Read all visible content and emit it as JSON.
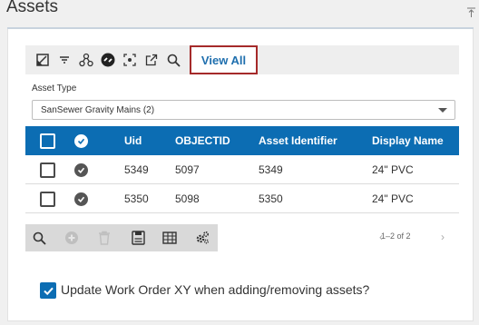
{
  "panel": {
    "title": "Assets"
  },
  "toolbar": {
    "icons": [
      "map-edit-icon",
      "filter-icon",
      "network-trace-icon",
      "link-icon",
      "focus-select-icon",
      "open-external-icon",
      "search-icon"
    ],
    "view_all_label": "View All"
  },
  "asset_type": {
    "label": "Asset Type",
    "selected": "SanSewer Gravity Mains (2)"
  },
  "grid": {
    "columns": [
      "Uid",
      "OBJECTID",
      "Asset Identifier",
      "Display Name"
    ],
    "rows": [
      {
        "uid": "5349",
        "objectid": "5097",
        "asset_identifier": "5349",
        "display_name": "24\" PVC"
      },
      {
        "uid": "5350",
        "objectid": "5098",
        "asset_identifier": "5350",
        "display_name": "24\" PVC"
      }
    ]
  },
  "bottom_toolbar": {
    "icons": [
      "zoom-icon",
      "add-icon",
      "delete-icon",
      "save-icon",
      "table-icon",
      "settings-icon"
    ]
  },
  "pager": {
    "text": "1–2 of 2"
  },
  "update_option": {
    "label": "Update Work Order XY when adding/removing assets?",
    "checked": true
  },
  "colors": {
    "header_blue": "#0c6db3",
    "view_all_border": "#a52a2a",
    "link_blue": "#1f6fae"
  }
}
